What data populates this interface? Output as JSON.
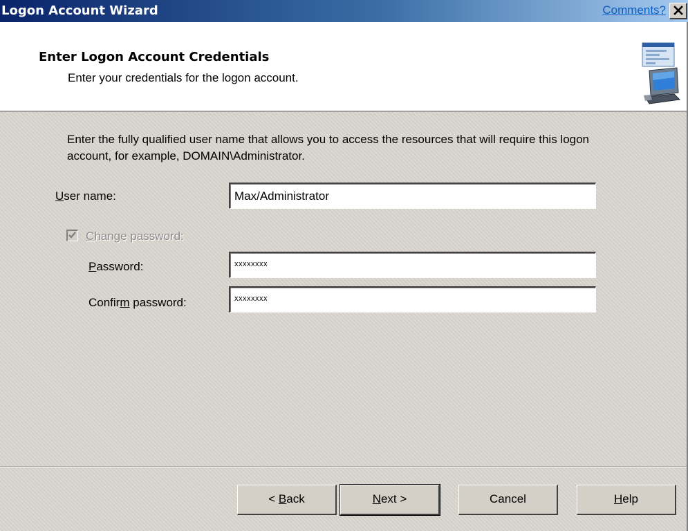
{
  "window": {
    "title": "Logon Account Wizard",
    "comments_link": "Comments?",
    "close_glyph": "✕"
  },
  "banner": {
    "heading": "Enter Logon Account Credentials",
    "subheading": "Enter your credentials for the logon account.",
    "icon": "computer-window-icon"
  },
  "form": {
    "instructions": "Enter the fully qualified user name that allows you to access the resources that will require this logon account, for example, DOMAIN\\Administrator.",
    "username_label_access": "U",
    "username_label_rest": "ser name:",
    "username_value": "Max/Administrator",
    "change_password_label_access": "C",
    "change_password_label_rest": "hange password:",
    "change_password_checked": true,
    "change_password_enabled": false,
    "password_label_access": "P",
    "password_label_rest": "assword:",
    "password_value": "xxxxxxxx",
    "confirm_label_pre": "Confir",
    "confirm_label_access": "m",
    "confirm_label_rest": " password:",
    "confirm_value": "xxxxxxxx"
  },
  "buttons": {
    "back_pre": "< ",
    "back_access": "B",
    "back_rest": "ack",
    "next_access": "N",
    "next_rest": "ext >",
    "cancel": "Cancel",
    "help_access": "H",
    "help_rest": "elp"
  },
  "colors": {
    "titlebar_start": "#0a246a",
    "titlebar_end": "#a6caf0",
    "face": "#d4d0c8",
    "disabled_text": "#8c8c8c"
  }
}
